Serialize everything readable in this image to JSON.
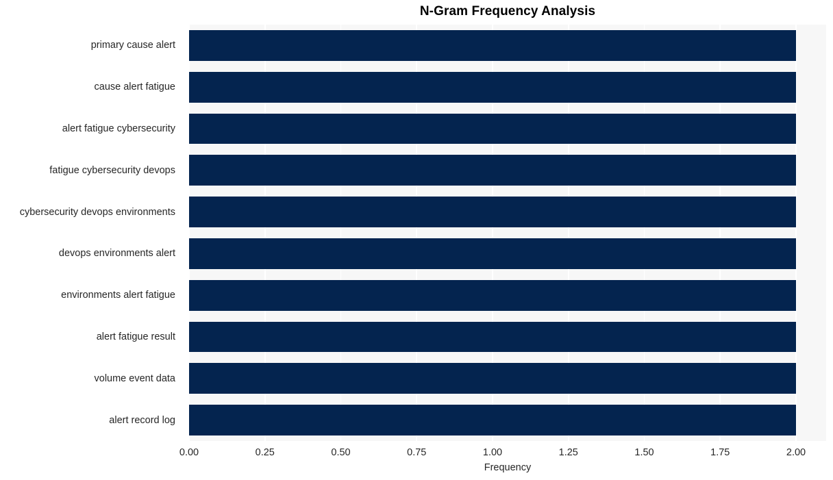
{
  "chart_data": {
    "type": "bar",
    "orientation": "horizontal",
    "title": "N-Gram Frequency Analysis",
    "xlabel": "Frequency",
    "ylabel": "",
    "categories": [
      "primary cause alert",
      "cause alert fatigue",
      "alert fatigue cybersecurity",
      "fatigue cybersecurity devops",
      "cybersecurity devops environments",
      "devops environments alert",
      "environments alert fatigue",
      "alert fatigue result",
      "volume event data",
      "alert record log"
    ],
    "values": [
      2,
      2,
      2,
      2,
      2,
      2,
      2,
      2,
      2,
      2
    ],
    "xlim": [
      0.0,
      2.0
    ],
    "xticks": [
      0.0,
      0.25,
      0.5,
      0.75,
      1.0,
      1.25,
      1.5,
      1.75,
      2.0
    ],
    "xticklabels": [
      "0.00",
      "0.25",
      "0.50",
      "0.75",
      "1.00",
      "1.25",
      "1.50",
      "1.75",
      "2.00"
    ],
    "grid": true,
    "grid_axis": "x",
    "legend": false,
    "bar_color": "#04244f",
    "plot_background": "#f7f7f7",
    "grid_color": "#ffffff",
    "text_color": "#262626",
    "figure_background": "#ffffff"
  }
}
